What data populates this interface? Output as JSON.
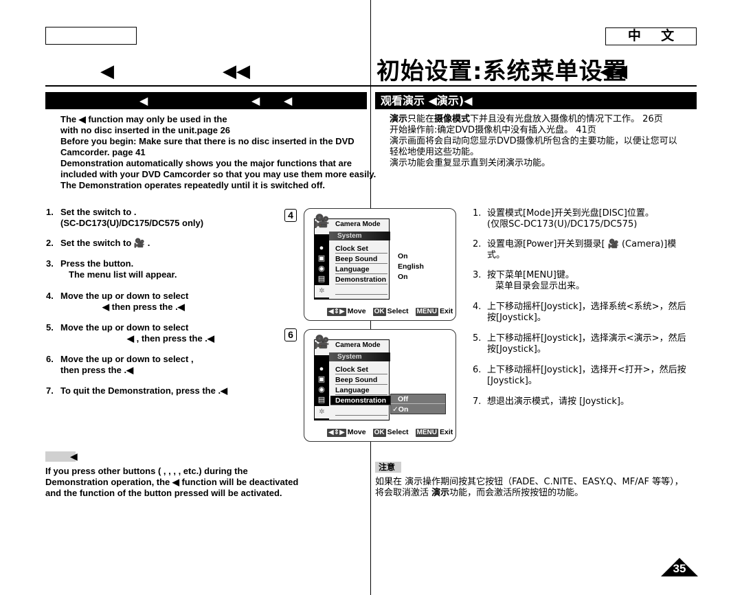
{
  "header": {
    "left_language_box": "",
    "right_language_box": "中 文",
    "left_title_markers": [
      "◀",
      "◀◀"
    ],
    "right_title": "初始设置:系统菜单设置",
    "right_title_marker": "◀◀"
  },
  "section": {
    "left_bar_markers": [
      "◀",
      "◀",
      "◀"
    ],
    "right_bar_title": "观看演示 ◀演示)◀"
  },
  "intro_en": [
    "The                    ◀ function may only be used in the",
    "with no disc inserted in the unit.page 26",
    "Before you begin: Make sure that there is no disc inserted in the DVD",
    "Camcorder.   page 41",
    "Demonstration automatically shows you the major functions that are",
    "included with your DVD Camcorder so that you may use them more easily.",
    "The Demonstration operates repeatedly until it is switched off."
  ],
  "intro_cn": {
    "line1_bold1": "演示",
    "line1_a": "只能在",
    "line1_bold2": "摄像模式",
    "line1_b": "下并且没有光盘放入摄像机的情况下工作。  26页",
    "line2": "开始操作前:确定DVD摄像机中没有插入光盘。  41页",
    "line3": "演示画面将会自动向您显示DVD摄像机所包含的主要功能，以便让您可以",
    "line4": "轻松地使用这些功能。",
    "line5": "演示功能会重复显示直到关闭演示功能。"
  },
  "steps_en": [
    {
      "num": "1.",
      "line1": "Set the            switch to          .",
      "line2": "(SC-DC173(U)/DC175/DC575 only)"
    },
    {
      "num": "2.",
      "line1": "Set the             switch to 🎥              ."
    },
    {
      "num": "3.",
      "line1": "Press the            button.",
      "line2": "The menu list will appear."
    },
    {
      "num": "4.",
      "line1": "Move the                   up or down to select",
      "line2": "◀ then press the             .◀"
    },
    {
      "num": "5.",
      "line1": "Move the                   up or down to select",
      "line2": "◀ , then press the             .◀"
    },
    {
      "num": "6.",
      "line1": "Move the                   up or down to select       ,",
      "line2": "then press the             .◀"
    },
    {
      "num": "7.",
      "line1": "To quit the Demonstration, press the             .◀"
    }
  ],
  "steps_cn": [
    {
      "num": "1.",
      "line1": "设置模式[Mode]开关到光盘[DISC]位置。",
      "line2": "(仅限SC-DC173(U)/DC175/DC575)"
    },
    {
      "num": "2.",
      "line1": "设置电源[Power]开关到摄录[ 🎥 (Camera)]模",
      "line2": "式。"
    },
    {
      "num": "3.",
      "line1": "按下菜单[MENU]键。",
      "line2": "菜单目录会显示出来。"
    },
    {
      "num": "4.",
      "line1": "上下移动摇杆[Joystick]，选择系统<系统>，然后",
      "line2": "按[Joystick]。"
    },
    {
      "num": "5.",
      "line1": "上下移动摇杆[Joystick]，选择演示<演示>，然后",
      "line2": "按[Joystick]。"
    },
    {
      "num": "6.",
      "line1": "上下移动摇杆[Joystick]，选择开<打开>，然后按",
      "line2": "[Joystick]。"
    },
    {
      "num": "7.",
      "line1": "想退出演示模式，请按 [Joystick]。"
    }
  ],
  "screens": [
    {
      "label": "4",
      "mode": "Camera Mode",
      "menu_title": "System",
      "items": [
        "Clock Set",
        "Beep Sound",
        "Language",
        "Demonstration"
      ],
      "values": [
        "",
        "On",
        "English",
        "On"
      ],
      "guide": {
        "move_key": "◀⇕▶",
        "move": "Move",
        "select_key": "OK",
        "select": "Select",
        "exit_key": "MENU",
        "exit": "Exit"
      }
    },
    {
      "label": "6",
      "mode": "Camera Mode",
      "menu_title": "System",
      "items": [
        "Clock Set",
        "Beep Sound",
        "Language",
        "Demonstration"
      ],
      "selected_item": "Demonstration",
      "submenu": [
        "Off",
        "✓On"
      ],
      "guide": {
        "move_key": "◀⇕▶",
        "move": "Move",
        "select_key": "OK",
        "select": "Select",
        "exit_key": "MENU",
        "exit": "Exit"
      }
    }
  ],
  "note_en": {
    "tag_marker": "◀",
    "lines": [
      "If you press other buttons (      ,              ,             ,            , etc.) during the",
      "Demonstration operation, the                       ◀ function will be deactivated",
      "and the function of the button pressed will be activated."
    ]
  },
  "note_cn": {
    "tag": "注意",
    "line1": "如果在 演示操作期间按其它按钮（FADE、C.NITE、EASY.Q、MF/AF 等等），",
    "line2_a": "将会取消激活 ",
    "line2_bold": "演示",
    "line2_b": "功能，而会激活所按按钮的功能。"
  },
  "page_number": "35"
}
